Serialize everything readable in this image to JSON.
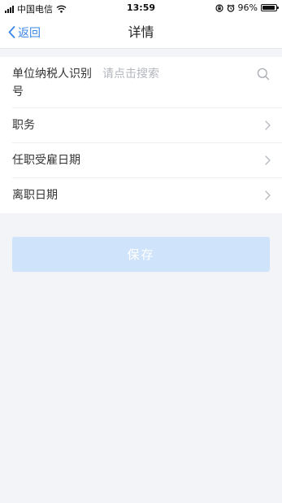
{
  "status_bar": {
    "carrier": "中国电信",
    "time": "13:59",
    "battery_percent": "96%",
    "battery_level": 0.96
  },
  "nav": {
    "back_label": "返回",
    "title": "详情"
  },
  "form": {
    "tax_id": {
      "label": "单位纳税人识别号",
      "placeholder": "请点击搜索",
      "value": ""
    },
    "position": {
      "label": "职务"
    },
    "employment_date": {
      "label": "任职受雇日期"
    },
    "leave_date": {
      "label": "离职日期"
    }
  },
  "actions": {
    "save_label": "保存"
  },
  "colors": {
    "accent": "#3b86e8",
    "save_disabled": "#cfe3fa",
    "background": "#f2f4f8"
  },
  "icons": {
    "signal": "signal-icon",
    "wifi": "wifi-icon",
    "lock": "orientation-lock-icon",
    "alarm": "alarm-icon",
    "battery": "battery-icon",
    "back": "chevron-left-icon",
    "search": "search-icon",
    "chevron": "chevron-right-icon"
  }
}
